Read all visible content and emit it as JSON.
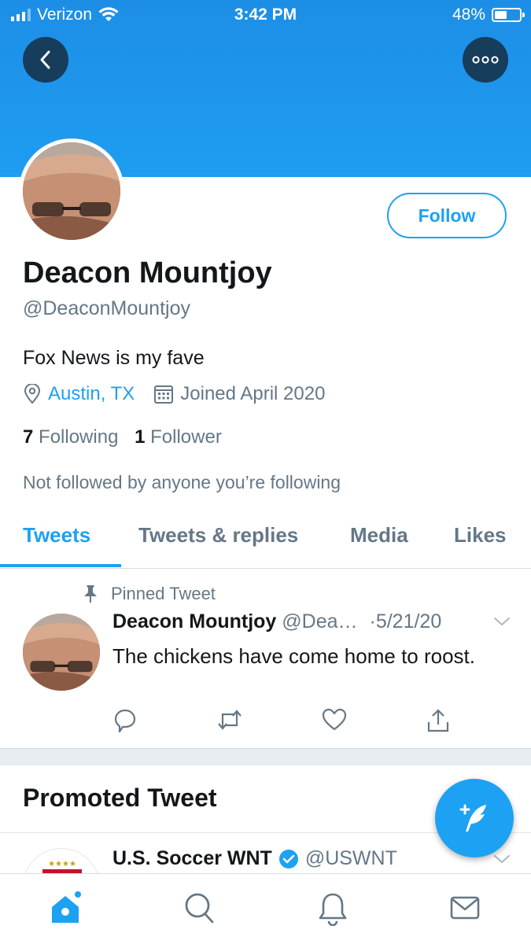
{
  "status_bar": {
    "carrier": "Verizon",
    "time": "3:42 PM",
    "battery": "48%",
    "battery_level": 0.48,
    "signal_icon": "signal-icon",
    "wifi_icon": "wifi-icon"
  },
  "header": {
    "back_icon": "back-arrow-icon",
    "more_icon": "more-options-icon",
    "banner_color": "#1da1f2"
  },
  "profile": {
    "name": "Deacon Mountjoy",
    "handle": "@DeaconMountjoy",
    "bio": "Fox News is my fave",
    "location": "Austin, TX",
    "joined": "Joined April 2020",
    "following_count": "7",
    "following_label": "Following",
    "followers_count": "1",
    "followers_label": "Follower",
    "not_followed": "Not followed by anyone you’re following",
    "follow_button": "Follow"
  },
  "tabs": [
    {
      "label": "Tweets",
      "active": true
    },
    {
      "label": "Tweets & replies",
      "active": false
    },
    {
      "label": "Media",
      "active": false
    },
    {
      "label": "Likes",
      "active": false
    }
  ],
  "pinned_tweet": {
    "pinned_label": "Pinned Tweet",
    "author_name": "Deacon Mountjoy",
    "author_handle": "@Dea…",
    "date": "·5/21/20",
    "text": "The chickens have come home to roost."
  },
  "promoted": {
    "heading": "Promoted Tweet",
    "author_name": "U.S. Soccer WNT",
    "author_handle": "@USWNT",
    "verified": true
  },
  "bottom_nav": [
    "home-icon",
    "search-icon",
    "notifications-icon",
    "messages-icon"
  ],
  "colors": {
    "accent": "#1da1f2",
    "secondary_text": "#657786",
    "button_dark": "#173d5c"
  }
}
